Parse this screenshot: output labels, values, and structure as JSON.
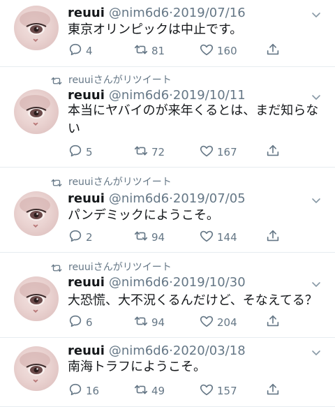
{
  "tweets": [
    {
      "retweet_by": "",
      "name": "reuui",
      "handle": "@nim6d6",
      "date": "2019/07/16",
      "text": "東京オリンピックは中止です。",
      "replies": "4",
      "retweets": "81",
      "likes": "160"
    },
    {
      "retweet_by": "reuuiさんがリツイート",
      "name": "reuui",
      "handle": "@nim6d6",
      "date": "2019/10/11",
      "text": "本当にヤバイのが来年くるとは、まだ知らな\nい",
      "replies": "5",
      "retweets": "72",
      "likes": "167"
    },
    {
      "retweet_by": "reuuiさんがリツイート",
      "name": "reuui",
      "handle": "@nim6d6",
      "date": "2019/07/05",
      "text": "パンデミックにようこそ。",
      "replies": "2",
      "retweets": "94",
      "likes": "144"
    },
    {
      "retweet_by": "reuuiさんがリツイート",
      "name": "reuui",
      "handle": "@nim6d6",
      "date": "2019/10/30",
      "text": "大恐慌、大不況くるんだけど、そなえてる？",
      "replies": "6",
      "retweets": "94",
      "likes": "204"
    },
    {
      "retweet_by": "",
      "name": "reuui",
      "handle": "@nim6d6",
      "date": "2020/03/18",
      "text": "南海トラフにようこそ。",
      "replies": "16",
      "retweets": "49",
      "likes": "157"
    }
  ],
  "icons": {
    "retweet_label": "retweet-icon",
    "reply": "reply-icon",
    "retweet": "retweet-icon",
    "like": "heart-icon",
    "share": "share-icon",
    "caret": "chevron-down-icon"
  },
  "colors": {
    "secondary_text": "#657786",
    "divider": "#e6ecf0",
    "primary_text": "#14171a"
  }
}
